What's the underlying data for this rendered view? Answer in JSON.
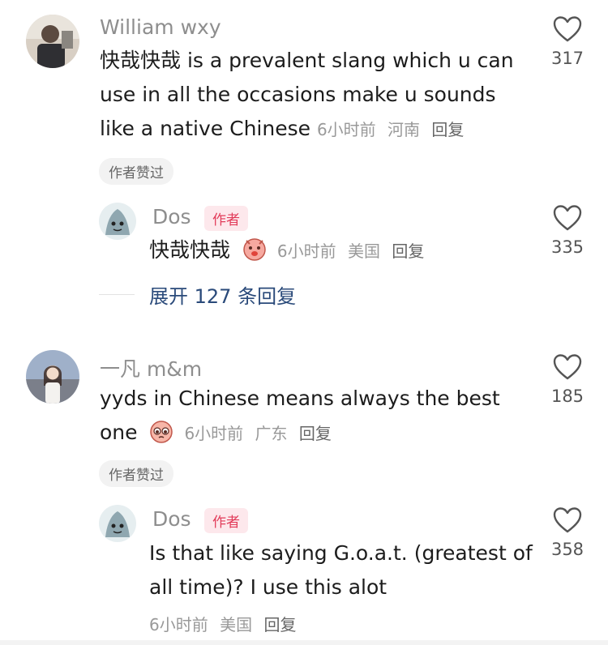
{
  "comments": [
    {
      "user": "William wxy",
      "text_line1": "快哉快哉 is a prevalent slang which u can",
      "text_line2": "use in all the occasions make u sounds",
      "text_line3": "like a native Chinese",
      "time": "6小时前",
      "location": "河南",
      "reply": "回复",
      "likes": "317",
      "badge": "作者赞过",
      "reply_item": {
        "user": "Dos",
        "author_tag": "作者",
        "text": "快哉快哉",
        "emoji": "smirk-face-emoji",
        "time": "6小时前",
        "location": "美国",
        "reply": "回复",
        "likes": "335"
      },
      "expand": "展开 127 条回复"
    },
    {
      "user": "一凡 m&m",
      "text_line1": "yyds in Chinese means always the best",
      "text_line2": "one",
      "emoji": "pleading-face-emoji",
      "time": "6小时前",
      "location": "广东",
      "reply": "回复",
      "likes": "185",
      "badge": "作者赞过",
      "reply_item": {
        "user": "Dos",
        "author_tag": "作者",
        "text_line1": "Is that like saying G.o.a.t. (greatest of",
        "text_line2": "all time)? I use this alot",
        "time": "6小时前",
        "location": "美国",
        "reply": "回复",
        "likes": "358"
      }
    }
  ],
  "colors": {
    "accent_pink": "#e23c5a",
    "link_blue": "#2a4a7a",
    "meta_gray": "#999999"
  }
}
